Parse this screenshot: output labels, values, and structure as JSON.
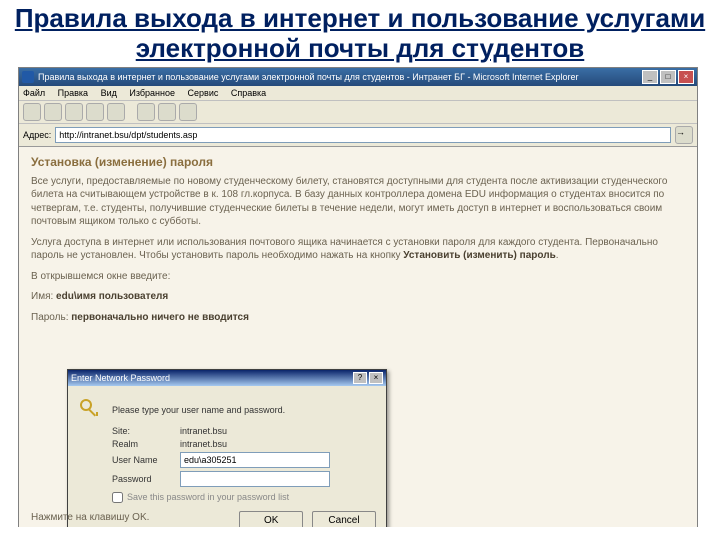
{
  "slide": {
    "title": "Правила выхода в интернет и пользование услугами электронной почты для студентов"
  },
  "browser": {
    "title": "Правила выхода в интернет и пользование услугами электронной почты для студентов - Интранет БГ - Microsoft Internet Explorer",
    "menu": {
      "file": "Файл",
      "edit": "Правка",
      "view": "Вид",
      "fav": "Избранное",
      "tools": "Сервис",
      "help": "Справка"
    },
    "addr_label": "Адрес:",
    "address": "http://intranet.bsu/dpt/students.asp",
    "go": "→",
    "win": {
      "min": "_",
      "max": "□",
      "close": "×"
    }
  },
  "page": {
    "heading": "Установка (изменение) пароля",
    "para1": "Все услуги, предоставляемые по новому студенческому билету, становятся доступными для студента после активизации студенческого билета на считывающем устройстве в к. 108 гл.корпуса. В базу данных контроллера домена EDU информация о студентах вносится по четвергам, т.е. студенты, получившие студенческие билеты в течение недели, могут иметь доступ в интернет и воспользоваться своим почтовым ящиком только с субботы.",
    "para2_a": "Услуга доступа в интернет или использования почтового ящика начинается с установки пароля для каждого студента. Первоначально пароль не установлен. Чтобы установить пароль необходимо нажать на кнопку ",
    "para2_b": "Установить (изменить) пароль",
    "para2_c": ".",
    "para3": "В открывшемся окне введите:",
    "para4_a": "Имя: ",
    "para4_b": "edu\\имя пользователя",
    "para5_a": "Пароль: ",
    "para5_b": "первоначально ничего не вводится",
    "footer": "Нажмите на клавишу OK."
  },
  "dialog": {
    "title": "Enter Network Password",
    "help": "?",
    "close": "×",
    "prompt": "Please type your user name and password.",
    "site_label": "Site:",
    "site_value": "intranet.bsu",
    "realm_label": "Realm",
    "realm_value": "intranet.bsu",
    "user_label": "User Name",
    "user_value": "edu\\a305251",
    "pass_label": "Password",
    "pass_value": "",
    "save_label": "Save this password in your password list",
    "ok": "OK",
    "cancel": "Cancel"
  }
}
